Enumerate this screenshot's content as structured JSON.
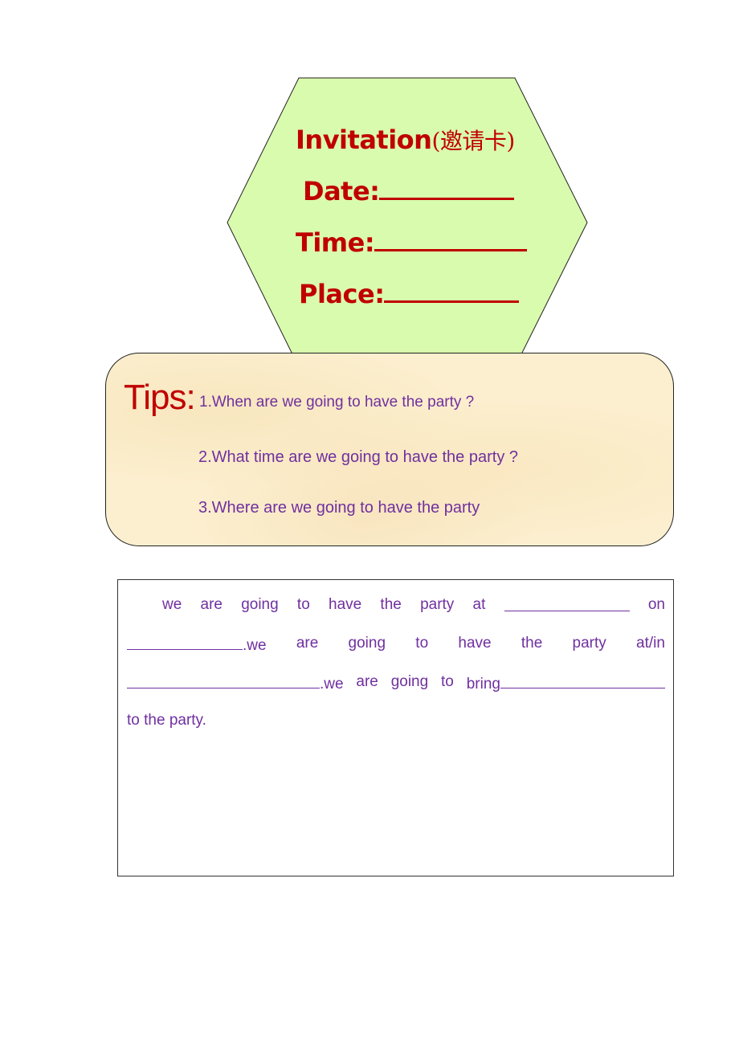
{
  "invitation": {
    "title": "Invitation",
    "title_cn": "(邀请卡)",
    "date_label": "Date:",
    "time_label": "Time:",
    "place_label": "Place:",
    "colors": {
      "fill": "#d9fbad",
      "text": "#c00000"
    }
  },
  "tips": {
    "label": "Tips:",
    "items": [
      "1.When are we going to have the party ?",
      "2.What time are we going to have the party ?",
      "3.Where are we going to have the party"
    ],
    "colors": {
      "label": "#c00000",
      "text": "#7030a0",
      "background": "#fcefcf"
    }
  },
  "passage": {
    "line1": [
      "we",
      "are",
      "going",
      "to",
      "have",
      "the",
      "party",
      "at",
      "",
      "on"
    ],
    "line2": [
      "",
      ".we",
      "are",
      "going",
      "to",
      "have",
      "the",
      "party",
      "at/in"
    ],
    "line3": [
      "",
      ".we",
      "are",
      "going",
      "to",
      "bring",
      ""
    ],
    "line4": "to the party."
  }
}
